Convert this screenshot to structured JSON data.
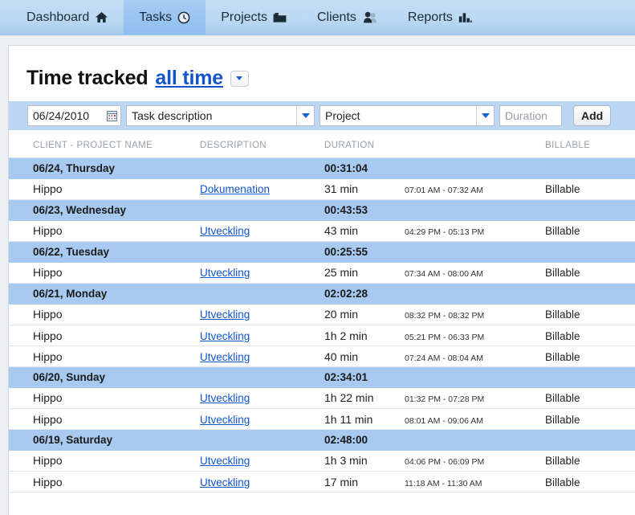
{
  "nav": {
    "tabs": [
      {
        "label": "Dashboard",
        "icon": "home-icon",
        "active": false
      },
      {
        "label": "Tasks",
        "icon": "clock-icon",
        "active": true
      },
      {
        "label": "Projects",
        "icon": "folder-icon",
        "active": false
      },
      {
        "label": "Clients",
        "icon": "people-icon",
        "active": false
      },
      {
        "label": "Reports",
        "icon": "bar-chart-icon",
        "active": false
      }
    ]
  },
  "header": {
    "title": "Time tracked",
    "range_link": "all time",
    "range_caret_icon": "chevron-down-icon"
  },
  "entry_form": {
    "date_value": "06/24/2010",
    "date_icon": "calendar-icon",
    "task_placeholder": "Task description",
    "task_value": "",
    "task_caret_icon": "chevron-down-icon",
    "project_placeholder": "Project",
    "project_value": "",
    "project_caret_icon": "chevron-down-icon",
    "duration_placeholder": "Duration",
    "duration_value": "",
    "add_label": "Add"
  },
  "table": {
    "columns": [
      "CLIENT - PROJECT NAME",
      "DESCRIPTION",
      "DURATION",
      "",
      "BILLABLE"
    ],
    "rows": [
      {
        "type": "day",
        "date": "06/24, Thursday",
        "total": "00:31:04"
      },
      {
        "type": "task",
        "client": "Hippo",
        "description": "Dokumenation",
        "duration": "31 min",
        "time_range": "07:01 AM - 07:32 AM",
        "billable": "Billable"
      },
      {
        "type": "day",
        "date": "06/23, Wednesday",
        "total": "00:43:53"
      },
      {
        "type": "task",
        "client": "Hippo",
        "description": "Utveckling",
        "duration": "43 min",
        "time_range": "04:29 PM - 05:13 PM",
        "billable": "Billable"
      },
      {
        "type": "day",
        "date": "06/22, Tuesday",
        "total": "00:25:55"
      },
      {
        "type": "task",
        "client": "Hippo",
        "description": "Utveckling",
        "duration": "25 min",
        "time_range": "07:34 AM - 08:00 AM",
        "billable": "Billable"
      },
      {
        "type": "day",
        "date": "06/21, Monday",
        "total": "02:02:28"
      },
      {
        "type": "task",
        "client": "Hippo",
        "description": "Utveckling",
        "duration": "20 min",
        "time_range": "08:32 PM - 08:32 PM",
        "billable": "Billable"
      },
      {
        "type": "task",
        "client": "Hippo",
        "description": "Utveckling",
        "duration": "1h 2 min",
        "time_range": "05:21 PM - 06:33 PM",
        "billable": "Billable"
      },
      {
        "type": "task",
        "client": "Hippo",
        "description": "Utveckling",
        "duration": "40 min",
        "time_range": "07:24 AM - 08:04 AM",
        "billable": "Billable"
      },
      {
        "type": "day",
        "date": "06/20, Sunday",
        "total": "02:34:01"
      },
      {
        "type": "task",
        "client": "Hippo",
        "description": "Utveckling",
        "duration": "1h 22 min",
        "time_range": "01:32 PM - 07:28 PM",
        "billable": "Billable"
      },
      {
        "type": "task",
        "client": "Hippo",
        "description": "Utveckling",
        "duration": "1h 11 min",
        "time_range": "08:01 AM - 09:06 AM",
        "billable": "Billable"
      },
      {
        "type": "day",
        "date": "06/19, Saturday",
        "total": "02:48:00"
      },
      {
        "type": "task",
        "client": "Hippo",
        "description": "Utveckling",
        "duration": "1h 3 min",
        "time_range": "04:06 PM - 06:09 PM",
        "billable": "Billable"
      },
      {
        "type": "task",
        "client": "Hippo",
        "description": "Utveckling",
        "duration": "17 min",
        "time_range": "11:18 AM - 11:30 AM",
        "billable": "Billable"
      }
    ]
  },
  "colors": {
    "nav_bg": "#bcd9f3",
    "nav_active": "#8fbef0",
    "day_row_bg": "#a8c9f0",
    "entry_bar_bg": "#bcd6f5",
    "link": "#1155cc",
    "page_bg": "#eceff1"
  }
}
